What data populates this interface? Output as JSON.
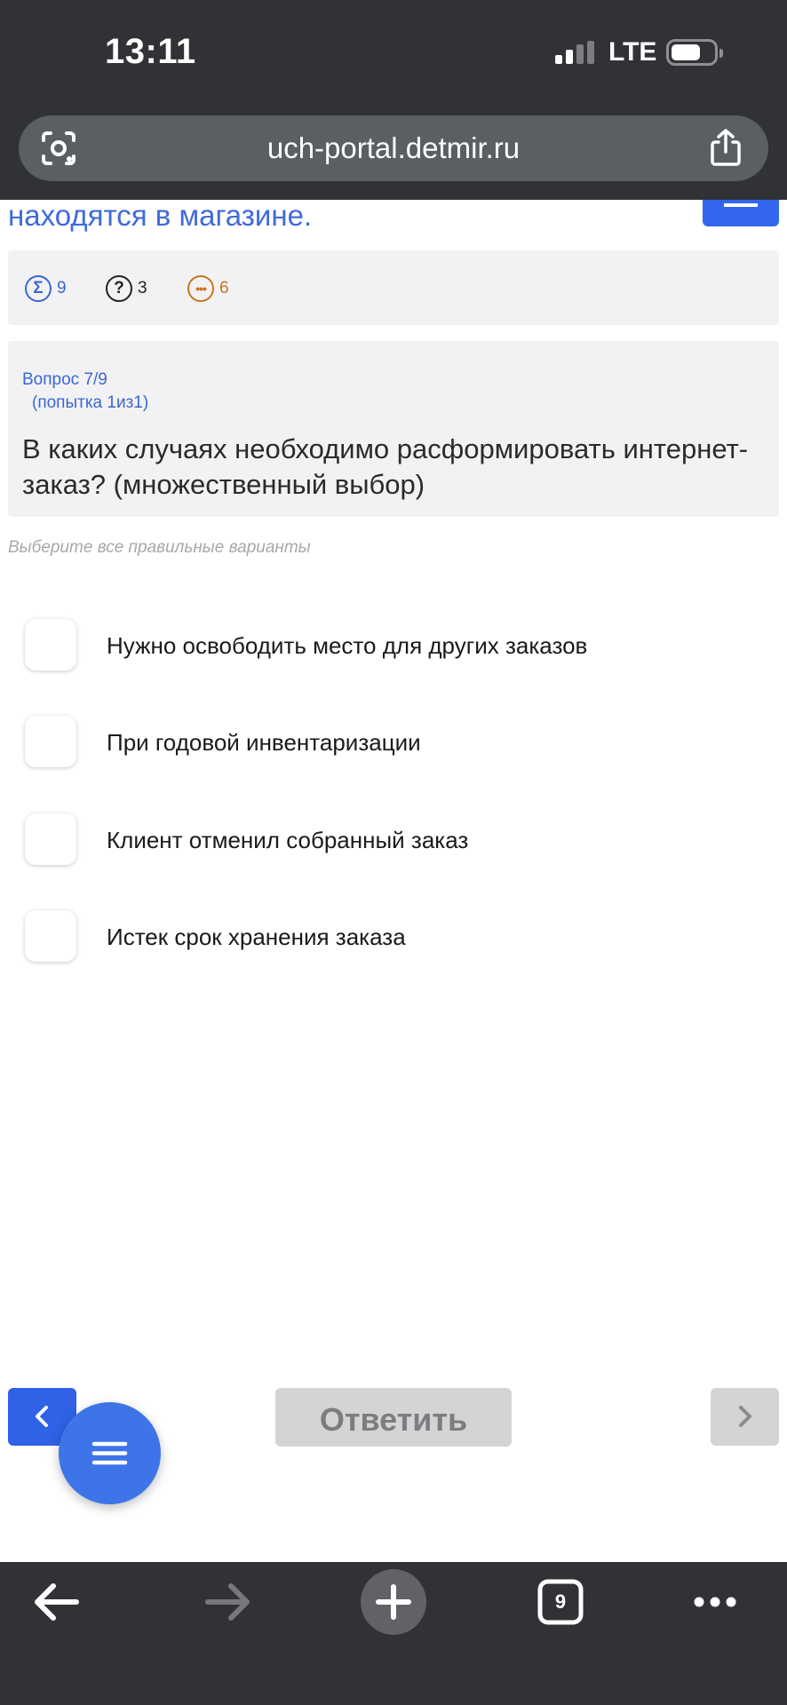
{
  "status_bar": {
    "time": "13:11",
    "network": "LTE"
  },
  "browser": {
    "url": "uch-portal.detmir.ru",
    "tab_count": "9",
    "icons": {
      "lens": "camera-search-icon",
      "share": "share-icon",
      "back": "arrow-left-icon",
      "forward": "arrow-right-icon",
      "new_tab": "plus-icon",
      "tabs": "tabs-icon",
      "more": "more-dots-icon"
    }
  },
  "page": {
    "partial_text": "находятся в магазине.",
    "stats": {
      "total": "9",
      "questions": "3",
      "pending": "6"
    },
    "question": {
      "counter": "Вопрос 7/9",
      "attempt": "(попытка 1из1)",
      "text": "В каких случаях необходимо расформировать интернет-заказ? (множественный выбор)"
    },
    "hint": "Выберите все правильные варианты",
    "options": [
      {
        "label": "Нужно освободить место для других заказов",
        "checked": false
      },
      {
        "label": "При годовой инвентаризации",
        "checked": false
      },
      {
        "label": "Клиент отменил собранный заказ",
        "checked": false
      },
      {
        "label": "Истек срок хранения заказа",
        "checked": false
      }
    ],
    "answer_button": "Ответить"
  },
  "colors": {
    "accent": "#2f62e6",
    "browser_chrome": "#303236",
    "disabled": "#d4d4d6",
    "pending": "#c8741a"
  }
}
